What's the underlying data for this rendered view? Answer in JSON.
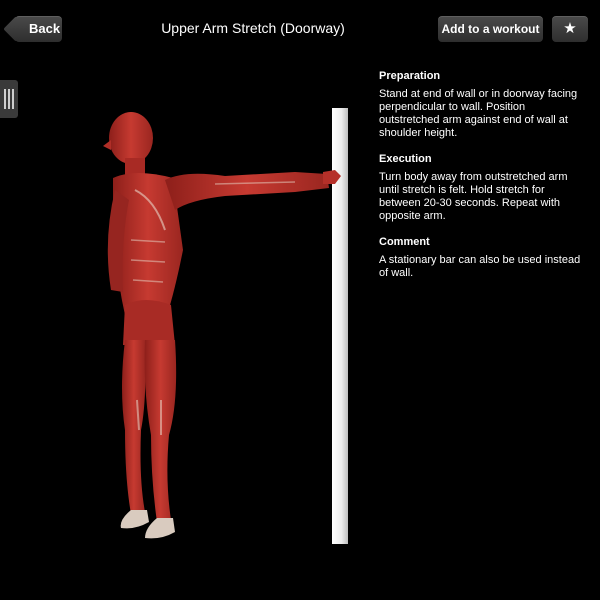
{
  "header": {
    "back_label": "Back",
    "title": "Upper Arm Stretch (Doorway)",
    "add_workout_label": "Add to a workout",
    "favorite_icon": "star-icon"
  },
  "sidebar": {
    "handle_icon": "menu-handle-icon"
  },
  "sections": [
    {
      "heading": "Preparation",
      "body": "Stand at end of wall or in doorway facing perpendicular to wall. Position outstretched arm against end of wall at shoulder height."
    },
    {
      "heading": "Execution",
      "body": "Turn body away from outstretched arm until stretch is felt. Hold stretch for between 20-30 seconds. Repeat with opposite arm."
    },
    {
      "heading": "Comment",
      "body": "A stationary bar can also be used instead of wall."
    }
  ],
  "colors": {
    "background": "#000000",
    "button": "#3b3b3b",
    "muscle": "#b8302a",
    "wall": "#f2f2f2"
  }
}
